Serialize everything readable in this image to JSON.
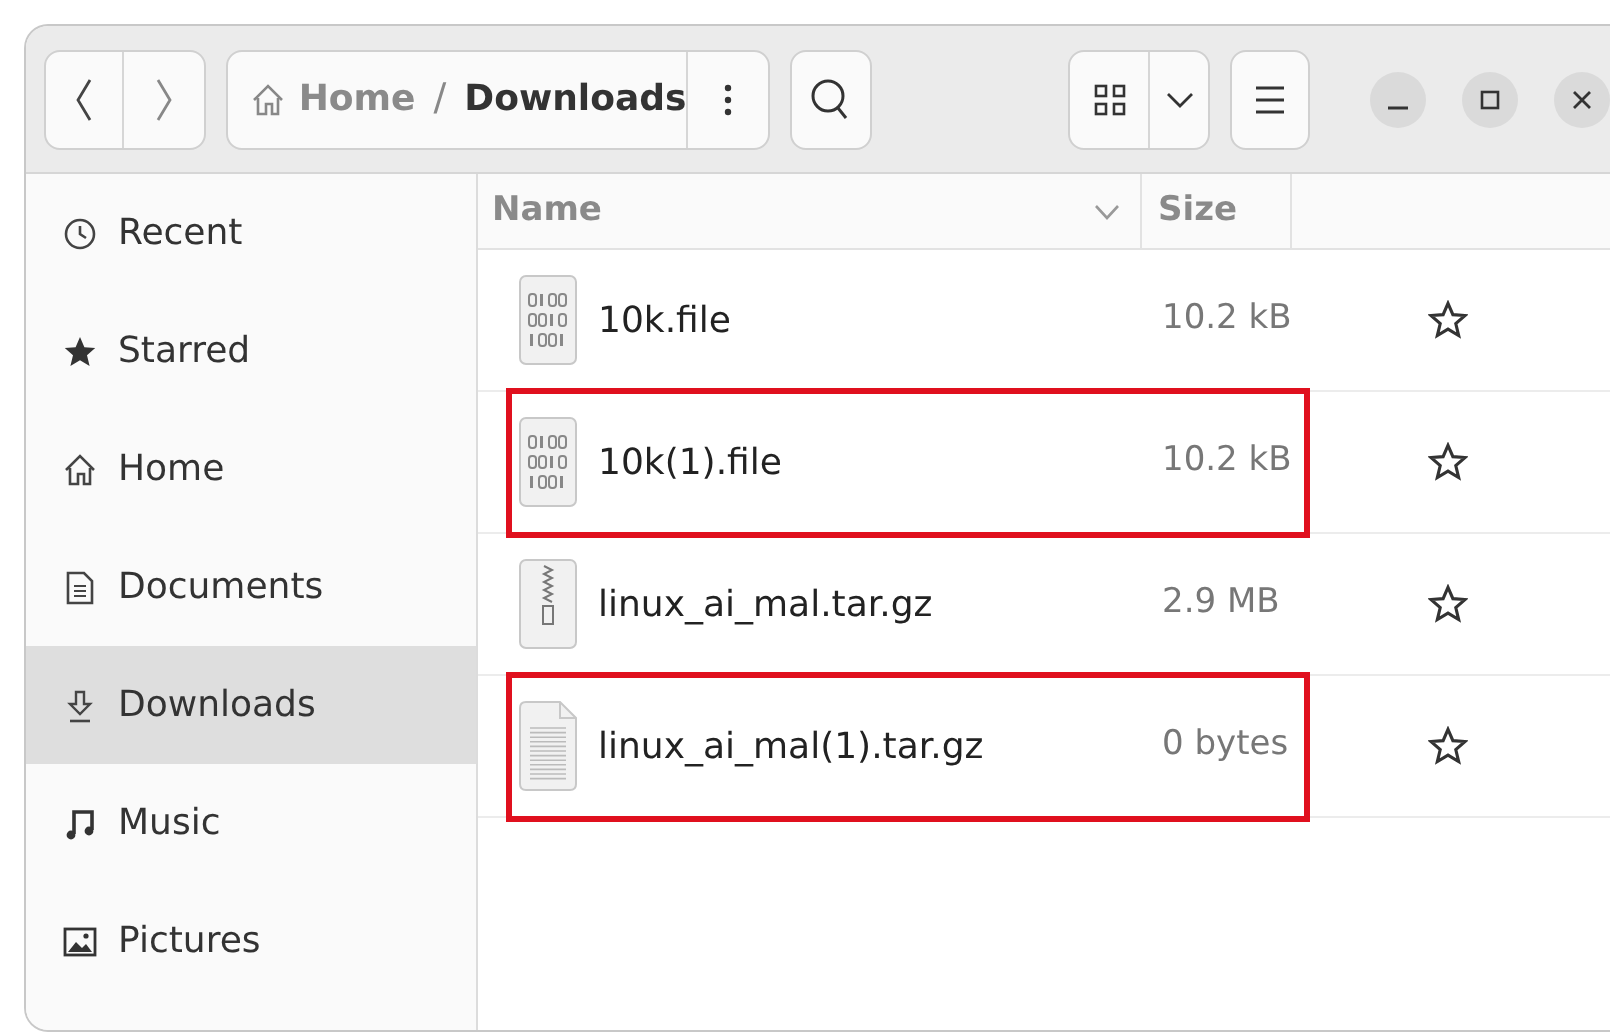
{
  "path_bar": {
    "separator": "/",
    "segments": [
      {
        "label": "Home",
        "selected": false
      },
      {
        "label": "Downloads",
        "selected": true
      }
    ]
  },
  "sidebar": {
    "items": [
      {
        "label": "Recent",
        "kind": "recent",
        "selected": false
      },
      {
        "label": "Starred",
        "kind": "starred",
        "selected": false
      },
      {
        "label": "Home",
        "kind": "home",
        "selected": false
      },
      {
        "label": "Documents",
        "kind": "documents",
        "selected": false
      },
      {
        "label": "Downloads",
        "kind": "downloads",
        "selected": true
      },
      {
        "label": "Music",
        "kind": "music",
        "selected": false
      },
      {
        "label": "Pictures",
        "kind": "pictures",
        "selected": false
      }
    ]
  },
  "table": {
    "columns": [
      "Name",
      "Size"
    ],
    "rows": [
      {
        "name": "10k.file",
        "size": "10.2 kB",
        "kind": "binary",
        "starred": false,
        "highlighted": false
      },
      {
        "name": "10k(1).file",
        "size": "10.2 kB",
        "kind": "binary",
        "starred": false,
        "highlighted": true
      },
      {
        "name": "linux_ai_mal.tar.gz",
        "size": "2.9 MB",
        "kind": "archive",
        "starred": false,
        "highlighted": false
      },
      {
        "name": "linux_ai_mal(1).tar.gz",
        "size": "0 bytes",
        "kind": "text",
        "starred": false,
        "highlighted": true
      }
    ]
  }
}
